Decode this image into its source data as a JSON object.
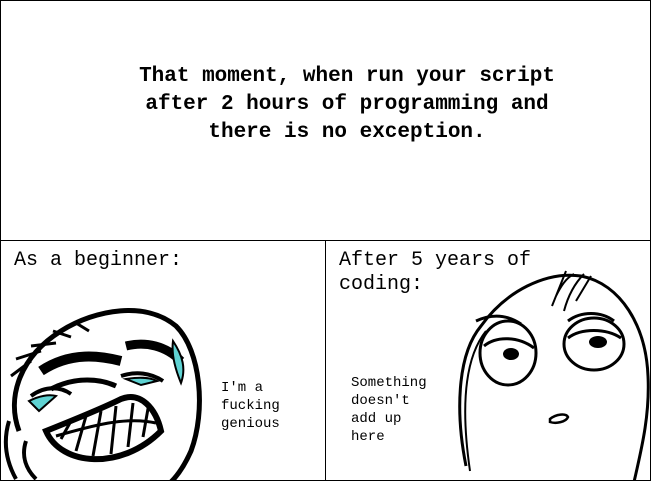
{
  "top_panel": {
    "headline": "That moment, when run your script\nafter 2 hours of programming and\nthere is no exception."
  },
  "left_panel": {
    "caption": "As a beginner:",
    "speech": "I'm a\nfucking\ngenious",
    "face_icon": "laughing-rage-face",
    "accent_color": "#5fd3d3"
  },
  "right_panel": {
    "caption": "After 5 years of\ncoding:",
    "speech": "Something\ndoesn't\nadd up\nhere",
    "face_icon": "suspicious-rage-face"
  }
}
